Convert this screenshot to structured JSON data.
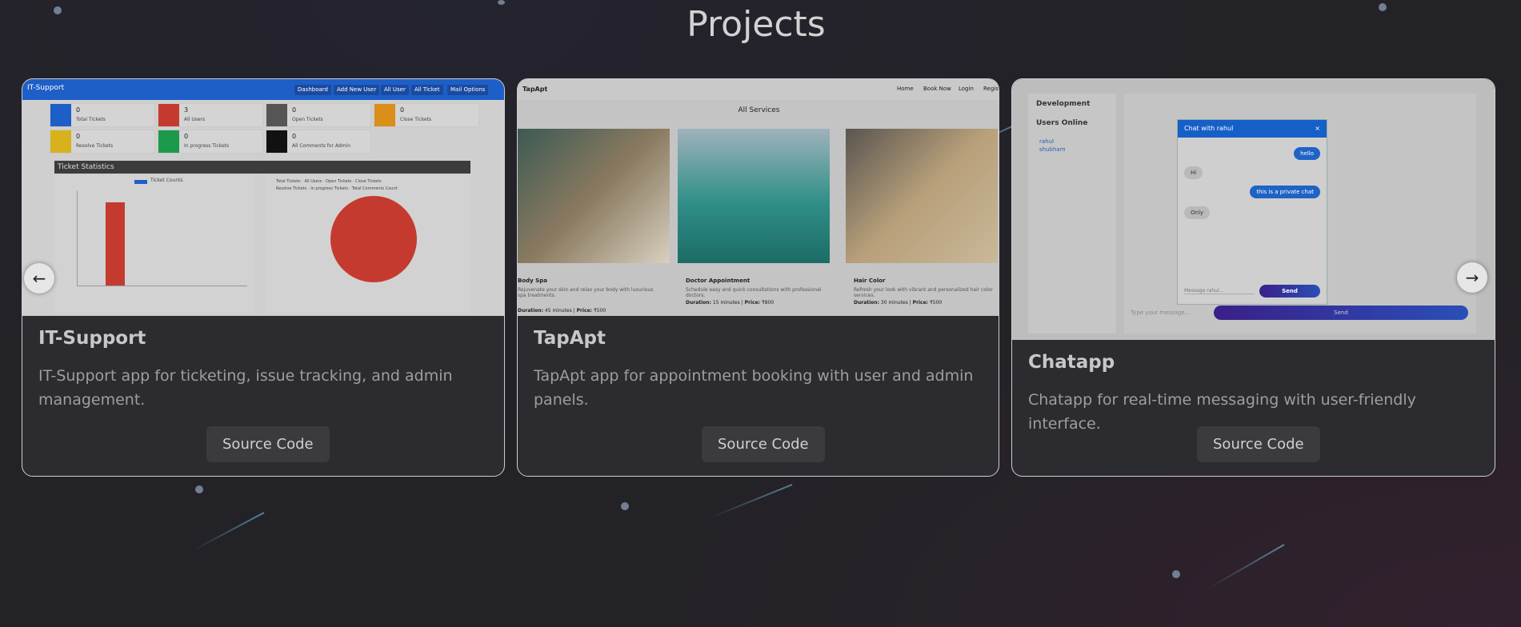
{
  "page": {
    "title": "Projects"
  },
  "projects": [
    {
      "title": "IT-Support",
      "description": "IT-Support app for ticketing, issue tracking, and admin management.",
      "button": "Source Code",
      "screenshot": {
        "app_title": "IT-Support",
        "nav": [
          "Dashboard",
          "Add New User",
          "All User",
          "All Ticket",
          "Mail Options"
        ],
        "stats": [
          {
            "value": "0",
            "label": "Total Tickets",
            "color": "#1d5fc7"
          },
          {
            "value": "3",
            "label": "All Users",
            "color": "#c53a2f"
          },
          {
            "value": "0",
            "label": "Open Tickets",
            "color": "#555555"
          },
          {
            "value": "0",
            "label": "Close Tickets",
            "color": "#d98f1a"
          },
          {
            "value": "0",
            "label": "Resolve Tickets",
            "color": "#d8b21c"
          },
          {
            "value": "0",
            "label": "In progress Tickets",
            "color": "#1b9a4c"
          },
          {
            "value": "0",
            "label": "All Comments for Admin",
            "color": "#111111"
          }
        ],
        "chart_heading": "Ticket Statistics",
        "bar_legend": "Ticket Counts",
        "pie_legend": [
          "Total Tickets",
          "All Users",
          "Open Tickets",
          "Close Tickets",
          "Resolve Tickets",
          "In progress Tickets",
          "Total Comments Count"
        ]
      }
    },
    {
      "title": "TapApt",
      "description": "TapApt app for appointment booking with user and admin panels.",
      "button": "Source Code",
      "screenshot": {
        "brand": "TapApt",
        "nav": [
          "Home",
          "Book Now",
          "Login",
          "Regist"
        ],
        "heading": "All Services",
        "services": [
          {
            "name": "Body Spa",
            "text": "Rejuvenate your skin and relax your body with luxurious spa treatments.",
            "duration": "45 minutes",
            "price": "₹500"
          },
          {
            "name": "Doctor Appointment",
            "text": "Schedule easy and quick consultations with professional doctors.",
            "duration": "15 minutes",
            "price": "₹800"
          },
          {
            "name": "Hair Color",
            "text": "Refresh your look with vibrant and personalized hair color services.",
            "duration": "30 minutes",
            "price": "₹500"
          }
        ],
        "duration_label": "Duration:",
        "price_label": "Price:"
      }
    },
    {
      "title": "Chatapp",
      "description": "Chatapp for real-time messaging with user-friendly interface.",
      "button": "Source Code",
      "screenshot": {
        "sidebar_heading": "Development",
        "online_heading": "Users Online",
        "users": [
          "rahul",
          "shubham"
        ],
        "popup_title": "Chat with rahul",
        "messages": [
          {
            "from": "me",
            "text": "hello"
          },
          {
            "from": "them",
            "text": "Hi"
          },
          {
            "from": "me",
            "text": "this is a private chat"
          },
          {
            "from": "them",
            "text": "Only"
          }
        ],
        "popup_placeholder": "Message rahul...",
        "popup_send": "Send",
        "main_placeholder": "Type your message...",
        "main_send": "Send"
      }
    }
  ],
  "arrows": {
    "prev": "←",
    "next": "→"
  }
}
